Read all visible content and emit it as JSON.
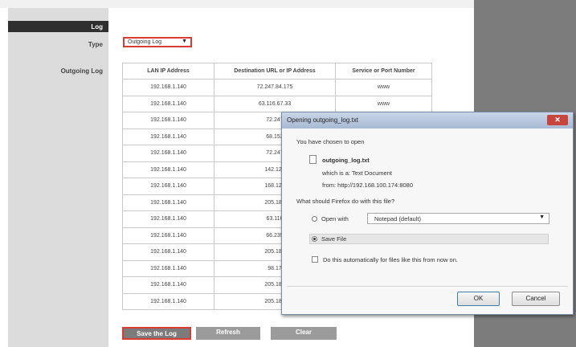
{
  "router": {
    "section_title": "Log",
    "type_label": "Type",
    "type_value": "Outgoing Log",
    "outgoing_log_label": "Outgoing Log",
    "table": {
      "headers": [
        "LAN IP Address",
        "Destination URL or IP Address",
        "Service or Port Number"
      ],
      "rows": [
        [
          "192.168.1.140",
          "72.247.84.175",
          "www"
        ],
        [
          "192.168.1.140",
          "63.116.67.33",
          "www"
        ],
        [
          "192.168.1.140",
          "72.247",
          ""
        ],
        [
          "192.168.1.140",
          "68.152",
          ""
        ],
        [
          "192.168.1.140",
          "72.247",
          ""
        ],
        [
          "192.168.1.140",
          "142.127",
          ""
        ],
        [
          "192.168.1.140",
          "168.122",
          ""
        ],
        [
          "192.168.1.140",
          "205.188",
          ""
        ],
        [
          "192.168.1.140",
          "63.116",
          ""
        ],
        [
          "192.168.1.140",
          "66.235",
          ""
        ],
        [
          "192.168.1.140",
          "205.188",
          ""
        ],
        [
          "192.168.1.140",
          "98.17",
          ""
        ],
        [
          "192.168.1.140",
          "205.188",
          ""
        ],
        [
          "192.168.1.140",
          "205.188",
          ""
        ]
      ]
    },
    "buttons": {
      "save": "Save the Log",
      "refresh": "Refresh",
      "clear": "Clear"
    }
  },
  "dialog": {
    "title": "Opening outgoing_log.txt",
    "close_icon": "close-icon",
    "intro": "You have chosen to open",
    "filename": "outgoing_log.txt",
    "which_is": "which is a:  Text Document",
    "from": "from:  http://192.168.100.174:8080",
    "question": "What should Firefox do with this file?",
    "open_with_label": "Open with",
    "open_with_app": "Notepad (default)",
    "save_file_label": "Save File",
    "selected_option": "save_file",
    "auto_label": "Do this automatically for files like this from now on.",
    "ok": "OK",
    "cancel": "Cancel"
  },
  "colors": {
    "highlight_red": "#d93c35",
    "close_button": "#c7453c",
    "right_background": "#7c7c7c"
  }
}
